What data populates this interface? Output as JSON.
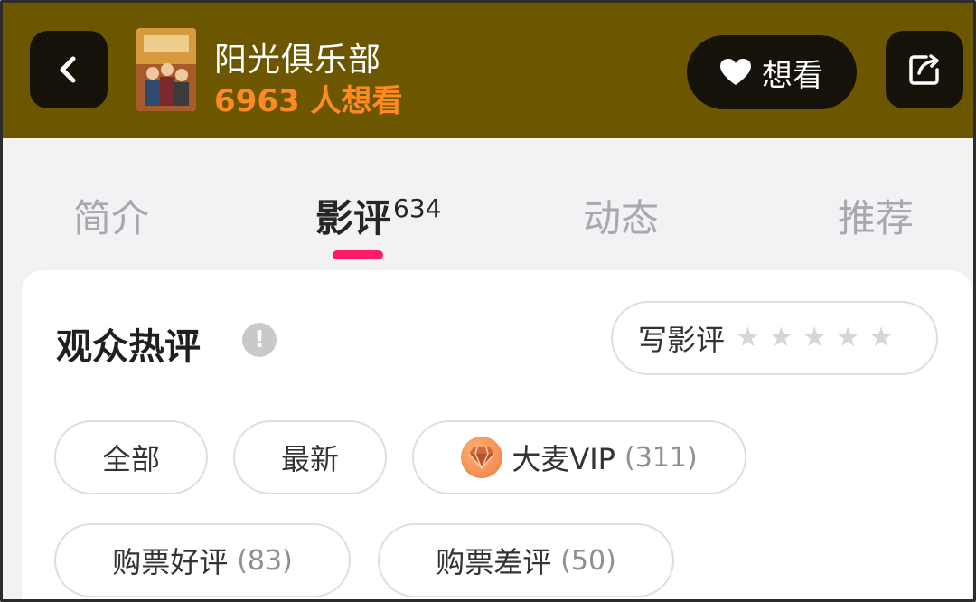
{
  "header": {
    "title": "阳光俱乐部",
    "want_count": "6963 人想看",
    "want_button_label": "想看"
  },
  "tabs": [
    {
      "label": "简介"
    },
    {
      "label": "影评",
      "count": "634",
      "active": true
    },
    {
      "label": "动态"
    },
    {
      "label": "推荐"
    }
  ],
  "reviews": {
    "section_title": "观众热评",
    "info_symbol": "!",
    "write_review_label": "写影评",
    "stars": [
      "★",
      "★",
      "★",
      "★",
      "★"
    ],
    "filters": [
      {
        "label": "全部"
      },
      {
        "label": "最新"
      },
      {
        "label": "大麦VIP",
        "count": "(311)",
        "icon": "diamond-icon"
      },
      {
        "label": "购票好评",
        "count": "(83)"
      },
      {
        "label": "购票差评",
        "count": "(50)"
      }
    ]
  },
  "colors": {
    "header_bg": "#6d5600",
    "accent_orange": "#ff8a1f",
    "tab_underline": "#ff1a66"
  }
}
